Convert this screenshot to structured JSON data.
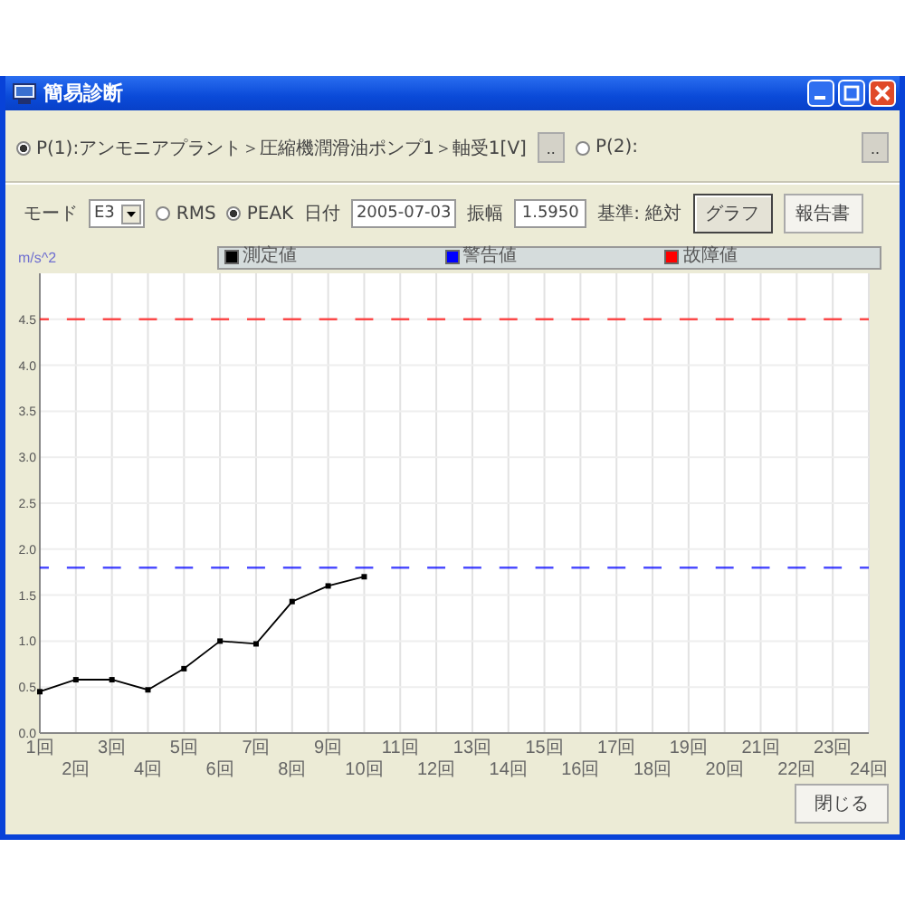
{
  "window": {
    "title": "簡易診断"
  },
  "points": [
    {
      "label": "P(1):アンモニアプラント＞圧縮機潤滑油ポンプ1＞軸受1[V]",
      "selected": true,
      "button": ".."
    },
    {
      "label": "P(2):",
      "selected": false,
      "button": ".."
    }
  ],
  "mode": {
    "label": "モード",
    "value": "E3"
  },
  "measures": [
    {
      "label": "RMS",
      "selected": false
    },
    {
      "label": "PEAK",
      "selected": true
    }
  ],
  "date": {
    "label": "日付",
    "value": "2005-07-03"
  },
  "amplitude": {
    "label": "振幅",
    "value": "1.5950"
  },
  "basis": "基準: 絶対",
  "buttons": [
    {
      "label": "グラフ",
      "pressed": true
    },
    {
      "label": "報告書",
      "pressed": false
    }
  ],
  "chart": {
    "chart_data": {
      "type": "line",
      "ylabel": "m/s^2",
      "grid": true,
      "categories": [
        "1回",
        "2回",
        "3回",
        "4回",
        "5回",
        "6回",
        "7回",
        "8回",
        "9回",
        "10回",
        "11回",
        "12回",
        "13回",
        "14回",
        "15回",
        "16回",
        "17回",
        "18回",
        "19回",
        "20回",
        "21回",
        "22回",
        "23回",
        "24回"
      ],
      "series": [
        {
          "name": "測定値",
          "color": "#000000",
          "line_style": "solid",
          "marker": "square",
          "values": [
            0.45,
            0.58,
            0.58,
            0.47,
            0.7,
            1.0,
            0.97,
            1.43,
            1.6,
            1.7,
            null,
            null,
            null,
            null,
            null,
            null,
            null,
            null,
            null,
            null,
            null,
            null,
            null,
            null
          ]
        },
        {
          "name": "警告値",
          "color": "#0000ff",
          "line_style": "dashed",
          "values": [
            1.8,
            1.8,
            1.8,
            1.8,
            1.8,
            1.8,
            1.8,
            1.8,
            1.8,
            1.8,
            1.8,
            1.8,
            1.8,
            1.8,
            1.8,
            1.8,
            1.8,
            1.8,
            1.8,
            1.8,
            1.8,
            1.8,
            1.8,
            1.8
          ]
        },
        {
          "name": "故障値",
          "color": "#ff0000",
          "line_style": "dashed",
          "values": [
            4.5,
            4.5,
            4.5,
            4.5,
            4.5,
            4.5,
            4.5,
            4.5,
            4.5,
            4.5,
            4.5,
            4.5,
            4.5,
            4.5,
            4.5,
            4.5,
            4.5,
            4.5,
            4.5,
            4.5,
            4.5,
            4.5,
            4.5,
            4.5
          ]
        }
      ],
      "ylim": [
        0,
        5
      ],
      "yticks": [
        {
          "value": 0,
          "label": "0.0"
        },
        {
          "value": 0.5,
          "label": "0.5"
        },
        {
          "value": 1,
          "label": "1.0"
        },
        {
          "value": 1.5,
          "label": "1.5"
        },
        {
          "value": 2,
          "label": "2.0"
        },
        {
          "value": 2.5,
          "label": "2.5"
        },
        {
          "value": 3,
          "label": "3.0"
        },
        {
          "value": 3.5,
          "label": "3.5"
        },
        {
          "value": 4,
          "label": "4.0"
        },
        {
          "value": 4.5,
          "label": "4.5"
        }
      ]
    }
  },
  "close_button": "閉じる"
}
